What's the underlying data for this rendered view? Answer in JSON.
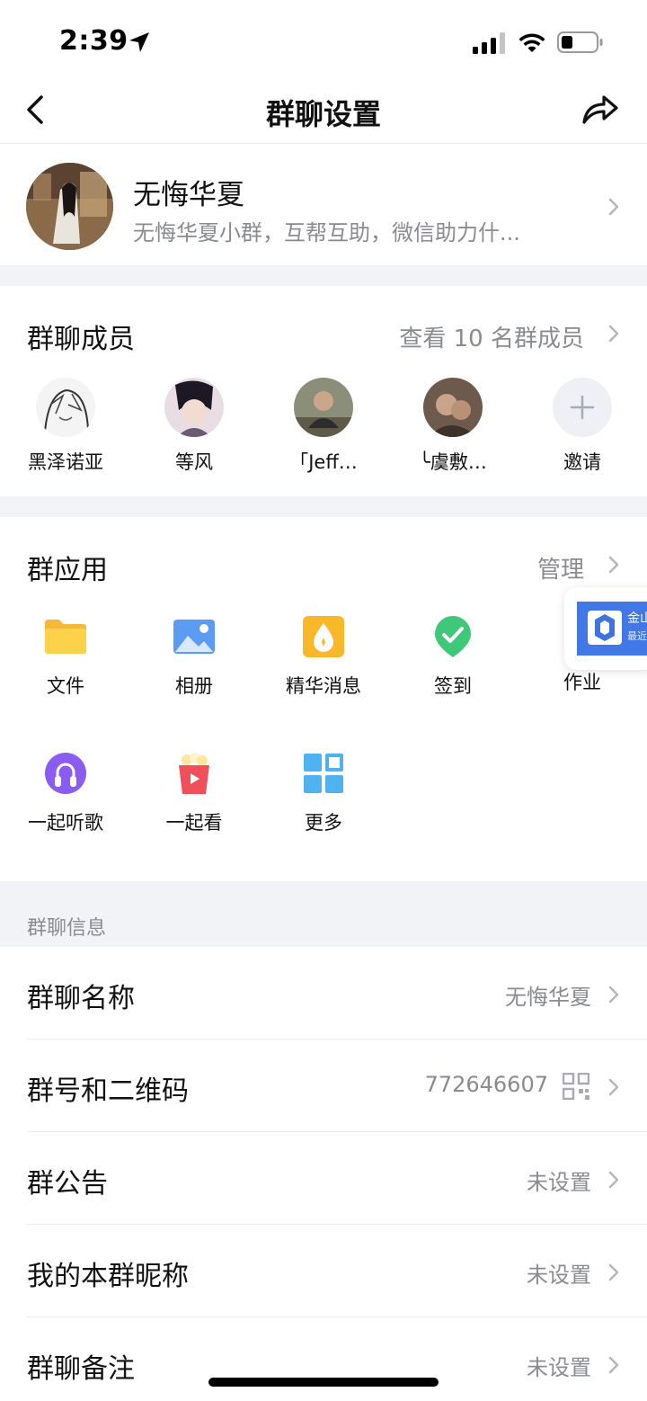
{
  "status_bar": {
    "time": "2:39"
  },
  "nav": {
    "title": "群聊设置"
  },
  "group": {
    "name": "无悔华夏",
    "description": "无悔华夏小群，互帮互助，微信助力什..."
  },
  "members": {
    "title": "群聊成员",
    "view_all": "查看 10 名群成员",
    "list": [
      {
        "name": "黑泽诺亚"
      },
      {
        "name": "等风"
      },
      {
        "name": "「Jeff…"
      },
      {
        "name": "╰虞敷…"
      }
    ],
    "invite_label": "邀请"
  },
  "apps": {
    "title": "群应用",
    "manage": "管理",
    "items": [
      {
        "label": "文件",
        "icon": "folder-icon"
      },
      {
        "label": "相册",
        "icon": "album-icon"
      },
      {
        "label": "精华消息",
        "icon": "essence-icon"
      },
      {
        "label": "签到",
        "icon": "checkin-icon"
      },
      {
        "label": "作业",
        "icon": "homework-icon"
      },
      {
        "label": "一起听歌",
        "icon": "music-icon"
      },
      {
        "label": "一起看",
        "icon": "watch-icon"
      },
      {
        "label": "更多",
        "icon": "more-grid-icon"
      }
    ],
    "floating_card": {
      "title": "金山",
      "subtitle": "最近"
    }
  },
  "info": {
    "section_title": "群聊信息",
    "rows": [
      {
        "label": "群聊名称",
        "value": "无悔华夏"
      },
      {
        "label": "群号和二维码",
        "value": "772646607"
      },
      {
        "label": "群公告",
        "value": "未设置"
      },
      {
        "label": "我的本群昵称",
        "value": "未设置"
      },
      {
        "label": "群聊备注",
        "value": "未设置"
      }
    ]
  },
  "colors": {
    "accent": "#4278e6",
    "secondary_text": "#8a8b90",
    "section_bg": "#f2f3f6"
  }
}
